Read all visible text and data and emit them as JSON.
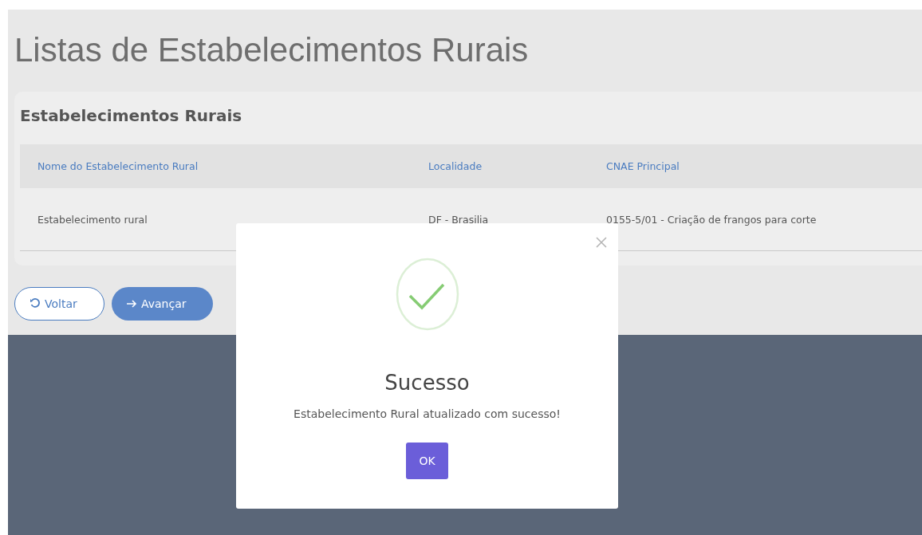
{
  "page": {
    "title": "Listas de Estabelecimentos Rurais"
  },
  "card": {
    "title": "Estabelecimentos Rurais"
  },
  "table": {
    "columns": [
      "Nome do Estabelecimento Rural",
      "Localidade",
      "CNAE Principal"
    ],
    "rows": [
      [
        "Estabelecimento rural",
        "DF - Brasilia",
        "0155-5/01 - Criação de frangos para corte"
      ]
    ]
  },
  "buttons": [
    {
      "kind": "back",
      "label": "Voltar"
    },
    {
      "kind": "next",
      "label": "Avançar"
    }
  ],
  "dialog": {
    "title": "Sucesso",
    "message": "Estabelecimento Rural atualizado com sucesso!",
    "button": "OK"
  }
}
